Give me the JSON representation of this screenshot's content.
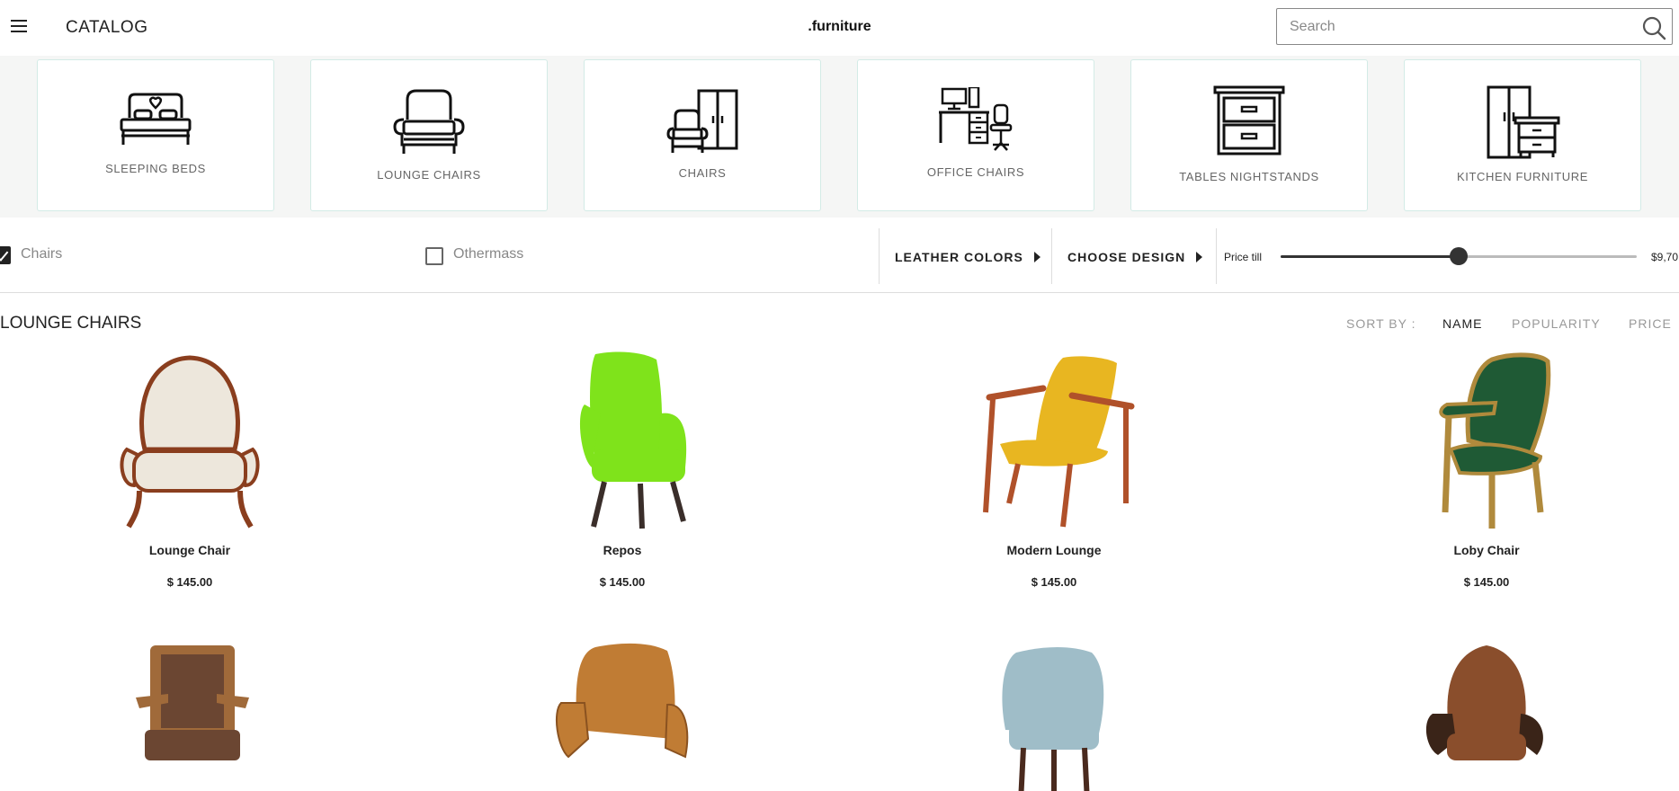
{
  "header": {
    "menu_icon": "hamburger-icon",
    "catalog_label": "CATALOG",
    "brand": ".furniture",
    "search_placeholder": "Search",
    "search_icon": "search-icon"
  },
  "categories": [
    {
      "label": "SLEEPING BEDS",
      "icon": "bed-icon"
    },
    {
      "label": "LOUNGE CHAIRS",
      "icon": "armchair-icon"
    },
    {
      "label": "CHAIRS",
      "icon": "chair-wardrobe-icon"
    },
    {
      "label": "OFFICE CHAIRS",
      "icon": "office-desk-icon"
    },
    {
      "label": "TABLES NIGHTSTANDS",
      "icon": "nightstand-icon"
    },
    {
      "label": "KITCHEN FURNITURE",
      "icon": "cabinet-icon"
    }
  ],
  "filters": {
    "checkboxes": [
      {
        "label": "Chairs",
        "checked": true
      },
      {
        "label": "Othermass",
        "checked": false
      }
    ],
    "leather_colors": "LEATHER COLORS",
    "choose_design": "CHOOSE DESIGN",
    "price_label": "Price till",
    "price_max": "$9,70",
    "price_slider_fraction": 0.5
  },
  "listing": {
    "title": "LOUNGE CHAIRS",
    "sort_by_label": "SORT BY :",
    "sort_options": [
      "NAME",
      "POPULARITY",
      "PRICE"
    ],
    "active_sort": "NAME"
  },
  "products": [
    {
      "name": "Lounge Chair",
      "price": "$ 145.00",
      "color": "#ede7dc",
      "frame": "#8a3e1e"
    },
    {
      "name": "Repos",
      "price": "$ 145.00",
      "color": "#7fe31b",
      "frame": "#3a2e2a"
    },
    {
      "name": "Modern Lounge",
      "price": "$ 145.00",
      "color": "#e8b621",
      "frame": "#b0512a"
    },
    {
      "name": "Loby Chair",
      "price": "$ 145.00",
      "color": "#1f5a35",
      "frame": "#b08a3c"
    },
    {
      "name": "",
      "price": "",
      "color": "#6b4632",
      "frame": "#a06a3a"
    },
    {
      "name": "",
      "price": "",
      "color": "#c07c34",
      "frame": "#7a4a22"
    },
    {
      "name": "",
      "price": "",
      "color": "#9fbdc8",
      "frame": "#4a2a1e"
    },
    {
      "name": "",
      "price": "",
      "color": "#8a4e2c",
      "frame": "#3a2418"
    }
  ]
}
